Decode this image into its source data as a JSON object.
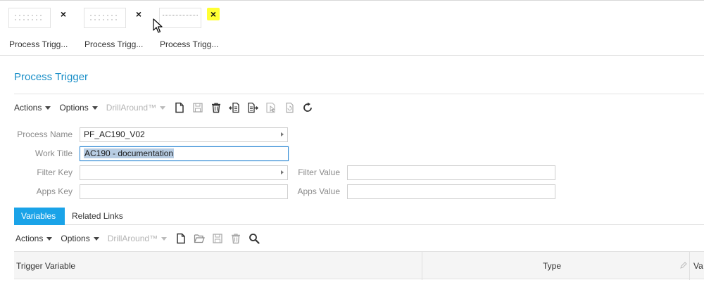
{
  "tabs": [
    {
      "label": "Process Trigg..."
    },
    {
      "label": "Process Trigg..."
    },
    {
      "label": "Process Trigg..."
    }
  ],
  "close_glyph": "×",
  "highlight_color": "#ffff33",
  "page": {
    "title": "Process Trigger"
  },
  "toolbar": {
    "actions": "Actions",
    "options": "Options",
    "drillaround": "DrillAround™",
    "icons": [
      "new-document-icon",
      "save-icon",
      "delete-icon",
      "import-icon",
      "export-icon",
      "select-icon",
      "copy-icon",
      "refresh-icon"
    ]
  },
  "form": {
    "process_name": {
      "label": "Process Name",
      "value": "PF_AC190_V02"
    },
    "work_title": {
      "label": "Work Title",
      "value": "AC190 - documentation"
    },
    "filter_key": {
      "label": "Filter Key",
      "value": ""
    },
    "filter_value": {
      "label": "Filter Value",
      "value": ""
    },
    "apps_key": {
      "label": "Apps Key",
      "value": ""
    },
    "apps_value": {
      "label": "Apps Value",
      "value": ""
    }
  },
  "subtabs": {
    "variables": "Variables",
    "related_links": "Related Links"
  },
  "grid_toolbar": {
    "actions": "Actions",
    "options": "Options",
    "drillaround": "DrillAround™",
    "icons": [
      "new-document-icon",
      "open-folder-icon",
      "save-icon",
      "delete-icon",
      "search-icon"
    ]
  },
  "grid": {
    "columns": [
      "Trigger Variable",
      "Type",
      "Va"
    ]
  },
  "colors": {
    "accent": "#1aa3e8",
    "title": "#1a8fc8",
    "focus": "#3b8fd6"
  }
}
